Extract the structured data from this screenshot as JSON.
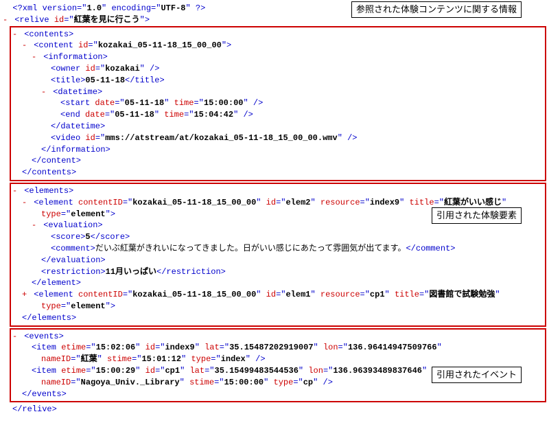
{
  "xml_decl": {
    "version": "1.0",
    "encoding": "UTF-8"
  },
  "relive": {
    "id": "紅葉を見に行こう"
  },
  "labels": {
    "contents_box": "参照された体験コンテンツに関する情報",
    "elements_box": "引用された体験要素",
    "events_box": "引用されたイベント"
  },
  "content": {
    "id": "kozakai_05-11-18_15_00_00",
    "owner_id": "kozakai",
    "title": "05-11-18",
    "start_date": "05-11-18",
    "start_time": "15:00:00",
    "end_date": "05-11-18",
    "end_time": "15:04:42",
    "video_id": "mms://atstream/at/kozakai_05-11-18_15_00_00.wmv"
  },
  "elem2": {
    "contentID": "kozakai_05-11-18_15_00_00",
    "id": "elem2",
    "resource": "index9",
    "title": "紅葉がいい感じ",
    "type": "element",
    "score": "5",
    "comment": "だいぶ紅葉がきれいになってきました。日がいい感じにあたって雰囲気が出てます。",
    "restriction": "11月いっぱい"
  },
  "elem1": {
    "contentID": "kozakai_05-11-18_15_00_00",
    "id": "elem1",
    "resource": "cp1",
    "title": "図書館で試験勉強",
    "type": "element"
  },
  "event1": {
    "etime": "15:02:06",
    "id": "index9",
    "lat": "35.15487202919007",
    "lon": "136.96414947509766",
    "nameID": "紅葉",
    "stime": "15:01:12",
    "type": "index"
  },
  "event2": {
    "etime": "15:00:29",
    "id": "cp1",
    "lat": "35.15499483544536",
    "lon": "136.96393489837646",
    "nameID": "Nagoya_Univ._Library",
    "stime": "15:00:00",
    "type": "cp"
  }
}
